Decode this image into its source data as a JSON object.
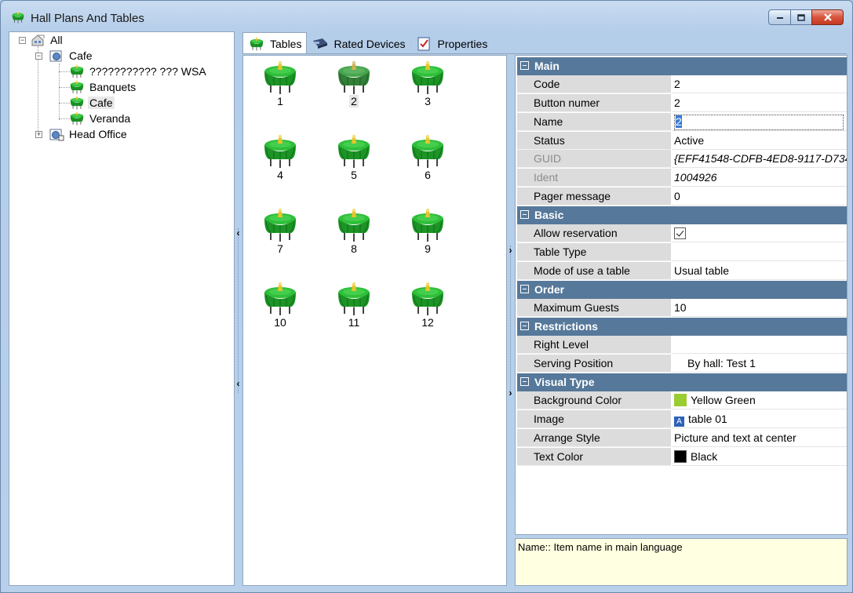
{
  "window": {
    "title": "Hall Plans And Tables"
  },
  "tree": {
    "root": "All",
    "cafe_group": "Cafe",
    "halls": [
      "??????????? ??? WSA",
      "Banquets",
      "Cafe",
      "Veranda"
    ],
    "head_office": "Head Office"
  },
  "tabs": [
    "Tables",
    "Rated Devices",
    "Properties"
  ],
  "tables": [
    "1",
    "2",
    "3",
    "4",
    "5",
    "6",
    "7",
    "8",
    "9",
    "10",
    "11",
    "12"
  ],
  "selected_table": "2",
  "properties": {
    "main": {
      "header": "Main",
      "code_label": "Code",
      "code_value": "2",
      "button_label": "Button numer",
      "button_value": "2",
      "name_label": "Name",
      "name_value": "2",
      "status_label": "Status",
      "status_value": "Active",
      "guid_label": "GUID",
      "guid_value": "{EFF41548-CDFB-4ED8-9117-D734",
      "ident_label": "Ident",
      "ident_value": "1004926",
      "pager_label": "Pager message",
      "pager_value": "0"
    },
    "basic": {
      "header": "Basic",
      "reservation_label": "Allow reservation",
      "reservation_checked": true,
      "table_type_label": "Table Type",
      "table_type_value": "",
      "mode_label": "Mode of use a table",
      "mode_value": "Usual table"
    },
    "order": {
      "header": "Order",
      "guests_label": "Maximum Guests",
      "guests_value": "10"
    },
    "restrictions": {
      "header": "Restrictions",
      "right_level_label": "Right Level",
      "right_level_value": "",
      "serving_label": "Serving Position",
      "serving_value": "By hall: Test 1"
    },
    "visual": {
      "header": "Visual Type",
      "bg_label": "Background Color",
      "bg_value": "Yellow Green",
      "bg_color": "#9acd32",
      "image_label": "Image",
      "image_value": "table 01",
      "arrange_label": "Arrange Style",
      "arrange_value": "Picture and text at center",
      "text_color_label": "Text Color",
      "text_color_value": "Black",
      "text_color": "#000000"
    }
  },
  "description": "Name:: Item name in main language",
  "colors": {
    "category_header": "#56789a",
    "description_bg": "#ffffe1",
    "table_green": "#1f9a2a"
  }
}
